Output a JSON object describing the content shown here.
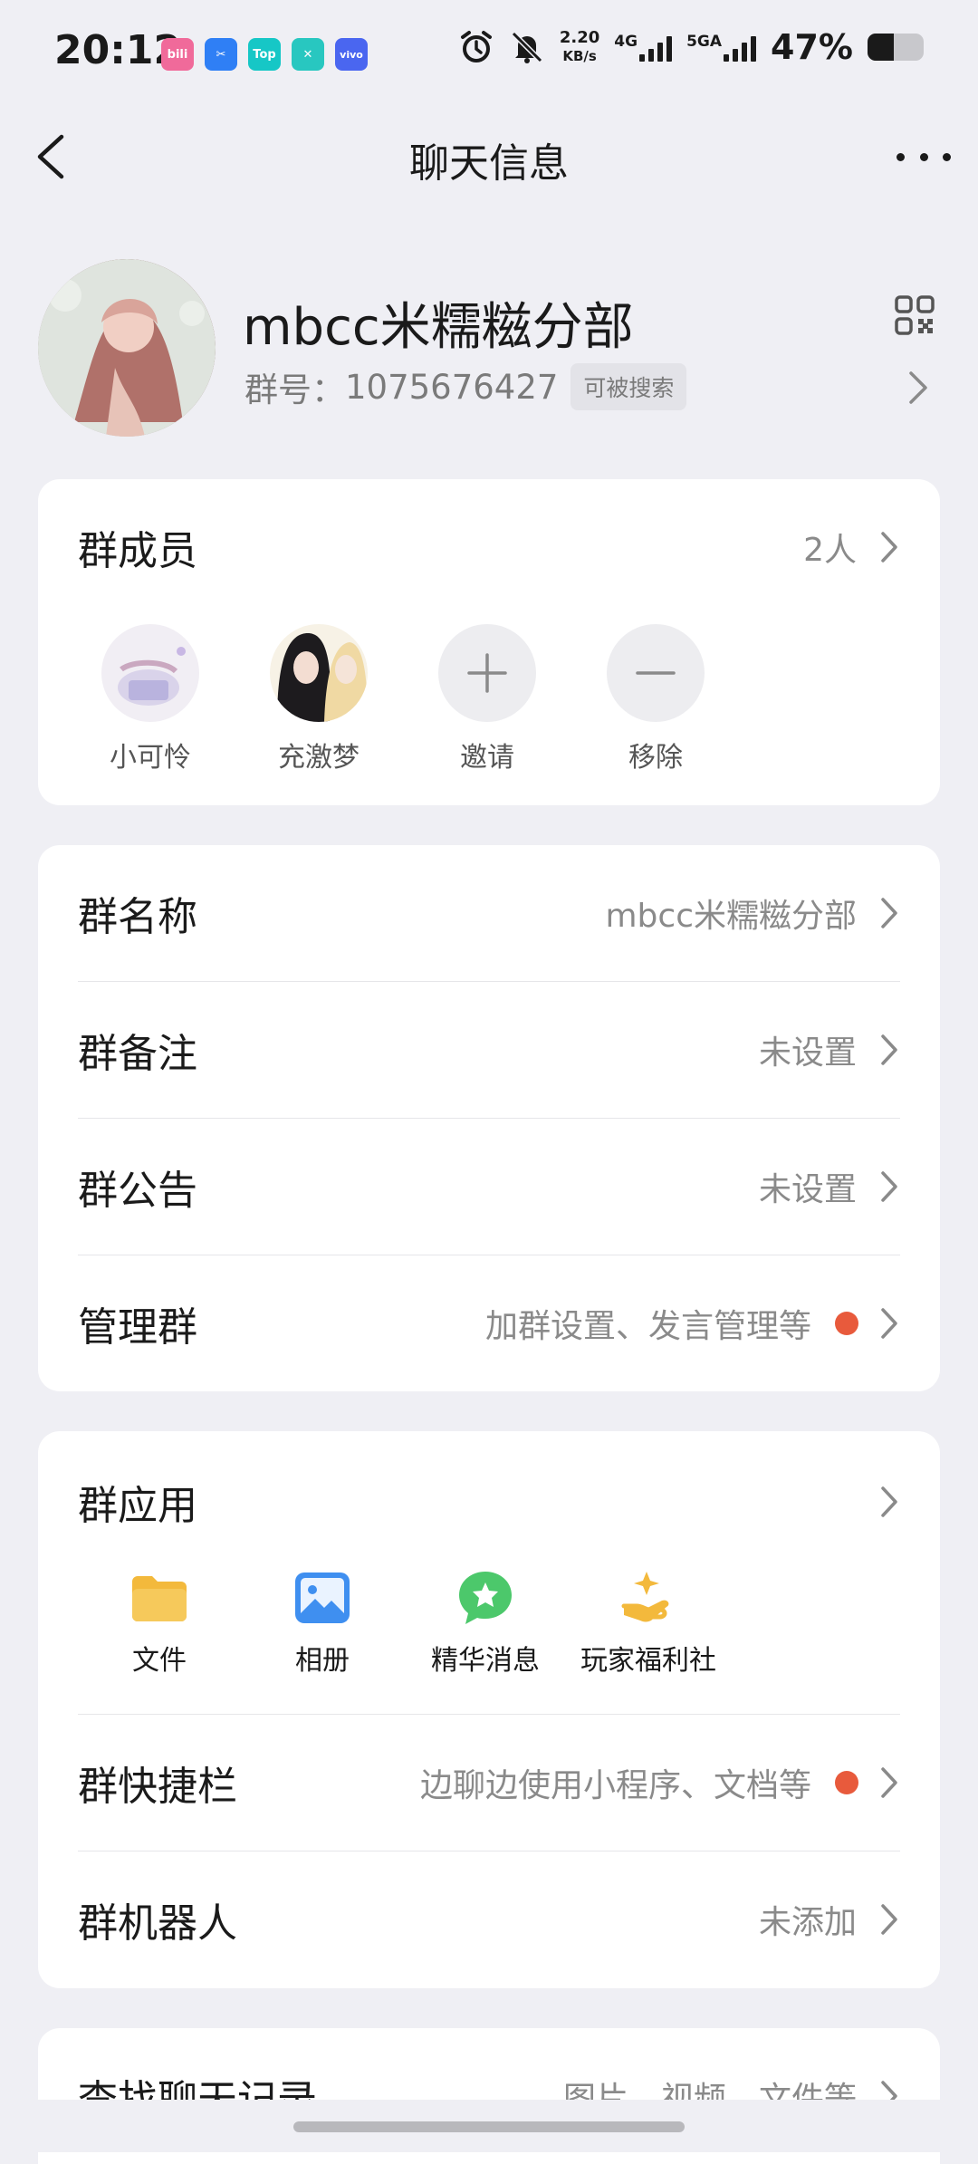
{
  "status_bar": {
    "time": "20:12",
    "app_icons": [
      {
        "name": "bilibili-icon",
        "text": "bili",
        "color": "#f06a9a"
      },
      {
        "name": "clip-app-icon",
        "text": "✂",
        "color": "#2f7ff5"
      },
      {
        "name": "taptap-icon",
        "text": "Top",
        "color": "#16c7c6"
      },
      {
        "name": "capcut-icon",
        "text": "✕",
        "color": "#28c7c0"
      },
      {
        "name": "vivo-icon",
        "text": "vivo",
        "color": "#4a66f0"
      }
    ],
    "net_speed_value": "2.20",
    "net_speed_unit": "KB/s",
    "net_type_1": "4G",
    "net_type_2": "5GA",
    "battery_percent": "47%",
    "battery_level": 0.47
  },
  "navbar": {
    "title": "聊天信息"
  },
  "group": {
    "name": "mbcc米糯糍分部",
    "id_label": "群号：",
    "id_value": "1075676427",
    "searchable_badge": "可被搜索"
  },
  "members_section": {
    "title": "群成员",
    "count": "2人",
    "members": [
      {
        "label": "小可怜"
      },
      {
        "label": "充激梦"
      }
    ],
    "invite_label": "邀请",
    "remove_label": "移除"
  },
  "settings": {
    "group_name": {
      "title": "群名称",
      "value": "mbcc米糯糍分部"
    },
    "group_remark": {
      "title": "群备注",
      "value": "未设置"
    },
    "group_notice": {
      "title": "群公告",
      "value": "未设置"
    },
    "manage_group": {
      "title": "管理群",
      "value": "加群设置、发言管理等"
    }
  },
  "apps_section": {
    "title": "群应用",
    "apps": [
      {
        "label": "文件"
      },
      {
        "label": "相册"
      },
      {
        "label": "精华消息"
      },
      {
        "label": "玩家福利社"
      }
    ],
    "shortcut_bar": {
      "title": "群快捷栏",
      "value": "边聊边使用小程序、文档等"
    },
    "robot": {
      "title": "群机器人",
      "value": "未添加"
    }
  },
  "search_history": {
    "title": "查找聊天记录",
    "value": "图片、视频、文件等"
  },
  "colors": {
    "accent_dot": "#e85a3c",
    "background": "#efeff4"
  }
}
